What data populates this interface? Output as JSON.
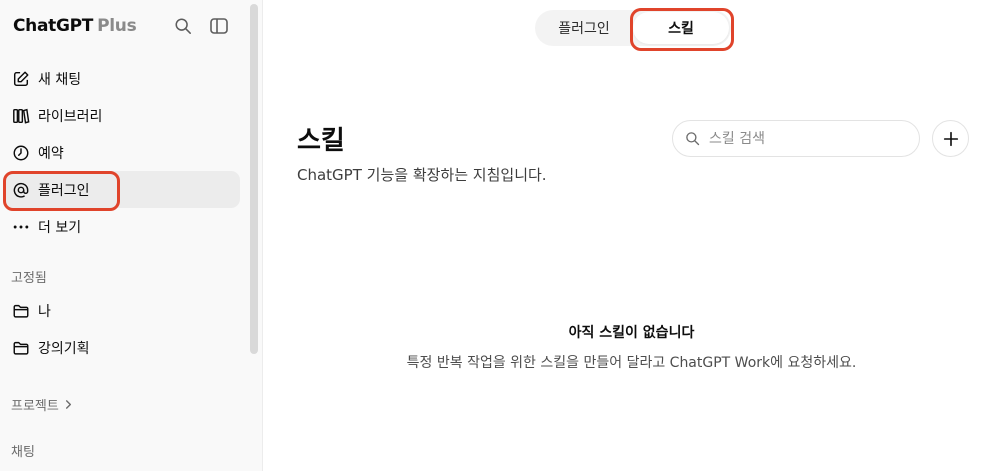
{
  "sidebar": {
    "brand": "ChatGPT",
    "brand_plan": "Plus",
    "items": [
      {
        "label": "새 채팅",
        "icon": "edit-icon"
      },
      {
        "label": "라이브러리",
        "icon": "library-icon"
      },
      {
        "label": "예약",
        "icon": "clock-icon"
      },
      {
        "label": "플러그인",
        "icon": "at-sign-icon"
      },
      {
        "label": "더 보기",
        "icon": "more-dots-icon"
      }
    ],
    "pinned_label": "고정됨",
    "pinned": [
      {
        "label": "나",
        "icon": "folder-icon"
      },
      {
        "label": "강의기획",
        "icon": "folder-icon"
      }
    ],
    "projects_label": "프로젝트",
    "chats_label": "채팅"
  },
  "tabs": [
    {
      "label": "플러그인"
    },
    {
      "label": "스킬"
    }
  ],
  "main": {
    "title": "스킬",
    "subtitle": "ChatGPT 기능을 확장하는 지침입니다.",
    "search_placeholder": "스킬 검색",
    "empty_title": "아직 스킬이 없습니다",
    "empty_desc": "특정 반복 작업을 위한 스킬을 만들어 달라고 ChatGPT Work에 요청하세요."
  },
  "colors": {
    "highlight": "#e0442b",
    "sidebar_bg": "#f9f9f9",
    "active_item_bg": "#ececec"
  }
}
